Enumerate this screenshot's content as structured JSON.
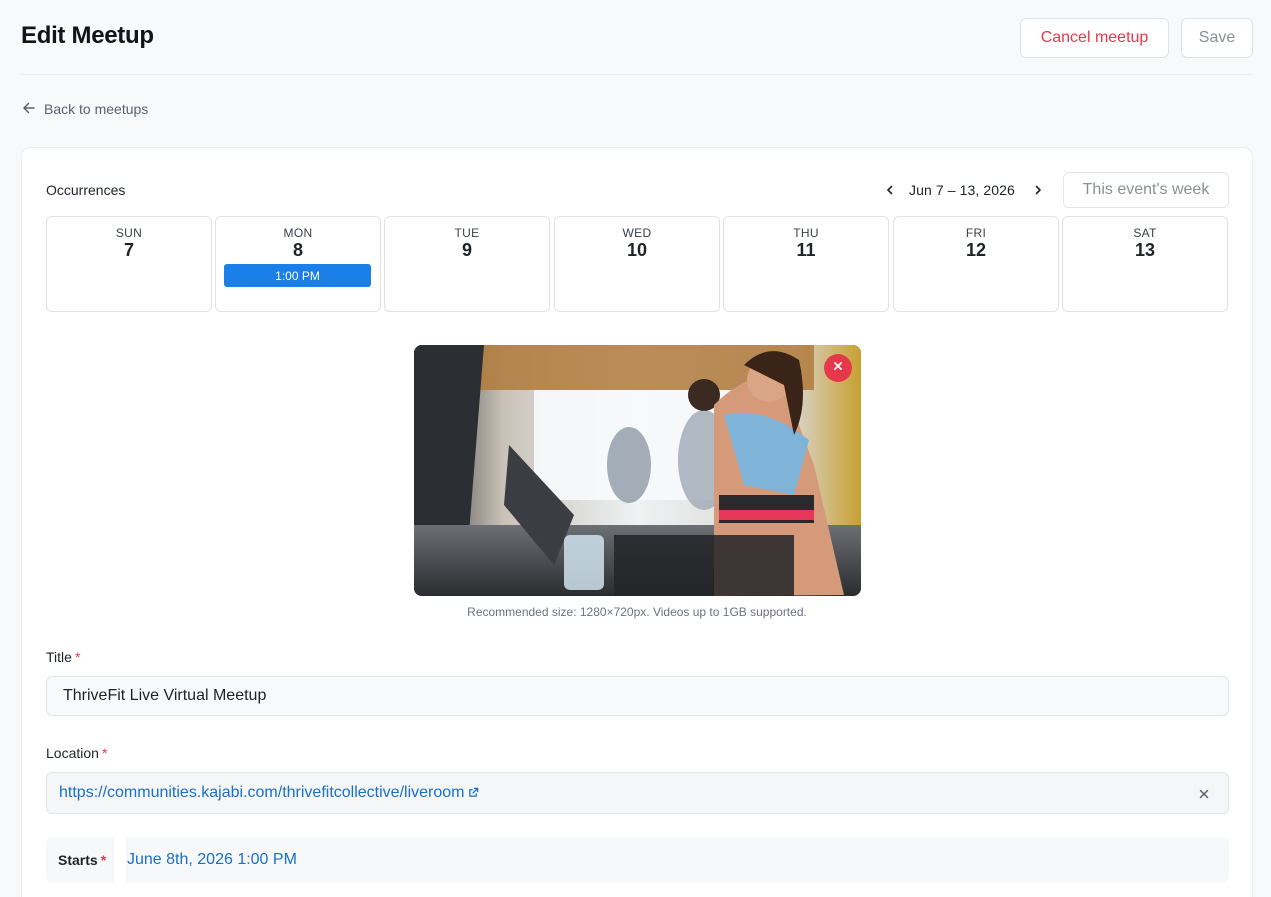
{
  "header": {
    "title": "Edit Meetup",
    "cancel_label": "Cancel meetup",
    "save_label": "Save"
  },
  "back_link": {
    "label": "Back to meetups",
    "icon": "arrow-left-icon"
  },
  "occurrences": {
    "label": "Occurrences",
    "week_range": "Jun 7 – 13, 2026",
    "this_week_label": "This event's week",
    "days": [
      {
        "name": "SUN",
        "num": "7"
      },
      {
        "name": "MON",
        "num": "8",
        "event": "1:00 PM"
      },
      {
        "name": "TUE",
        "num": "9"
      },
      {
        "name": "WED",
        "num": "10"
      },
      {
        "name": "THU",
        "num": "11"
      },
      {
        "name": "FRI",
        "num": "12"
      },
      {
        "name": "SAT",
        "num": "13"
      }
    ],
    "event_color": "#1a7fe8"
  },
  "cover": {
    "hint": "Recommended size: 1280×720px. Videos up to 1GB supported.",
    "remove_icon": "close-icon"
  },
  "form": {
    "title_label": "Title",
    "title_value": "ThriveFit Live Virtual Meetup",
    "location_label": "Location",
    "location_url": "https://communities.kajabi.com/thrivefitcollective/liveroom",
    "required_mark": "*",
    "starts_label": "Starts",
    "starts_value": "June 8th, 2026 1:00 PM"
  },
  "colors": {
    "accent": "#1a7fe8",
    "danger": "#e5384a",
    "link": "#1a6fc9"
  }
}
